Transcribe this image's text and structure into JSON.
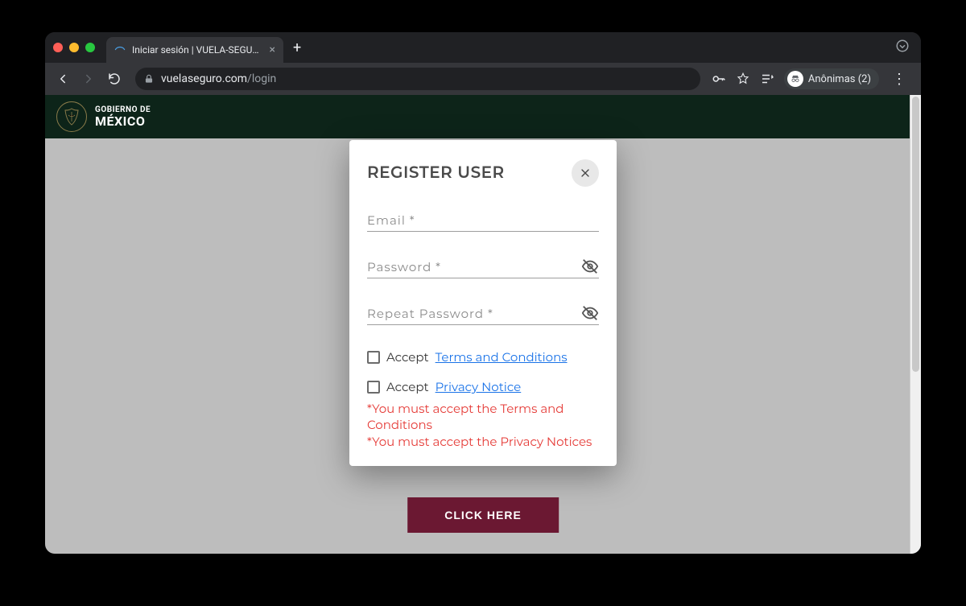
{
  "browser": {
    "tab_title": "Iniciar sesión | VUELA-SEGURO",
    "url_domain": "vuelaseguro.com",
    "url_path": "/login",
    "anonymous_label": "Anônimas (2)"
  },
  "site_header": {
    "line1": "GOBIERNO DE",
    "line2": "MÉXICO"
  },
  "page": {
    "click_here_label": "CLICK HERE"
  },
  "modal": {
    "title": "REGISTER USER",
    "email_label": "Email *",
    "password_label": "Password *",
    "repeat_password_label": "Repeat Password *",
    "accept_label": "Accept",
    "terms_link": "Terms and Conditions",
    "privacy_link": "Privacy Notice",
    "error_terms": "*You must accept the Terms and Conditions",
    "error_privacy": "*You must accept the Privacy Notices"
  }
}
